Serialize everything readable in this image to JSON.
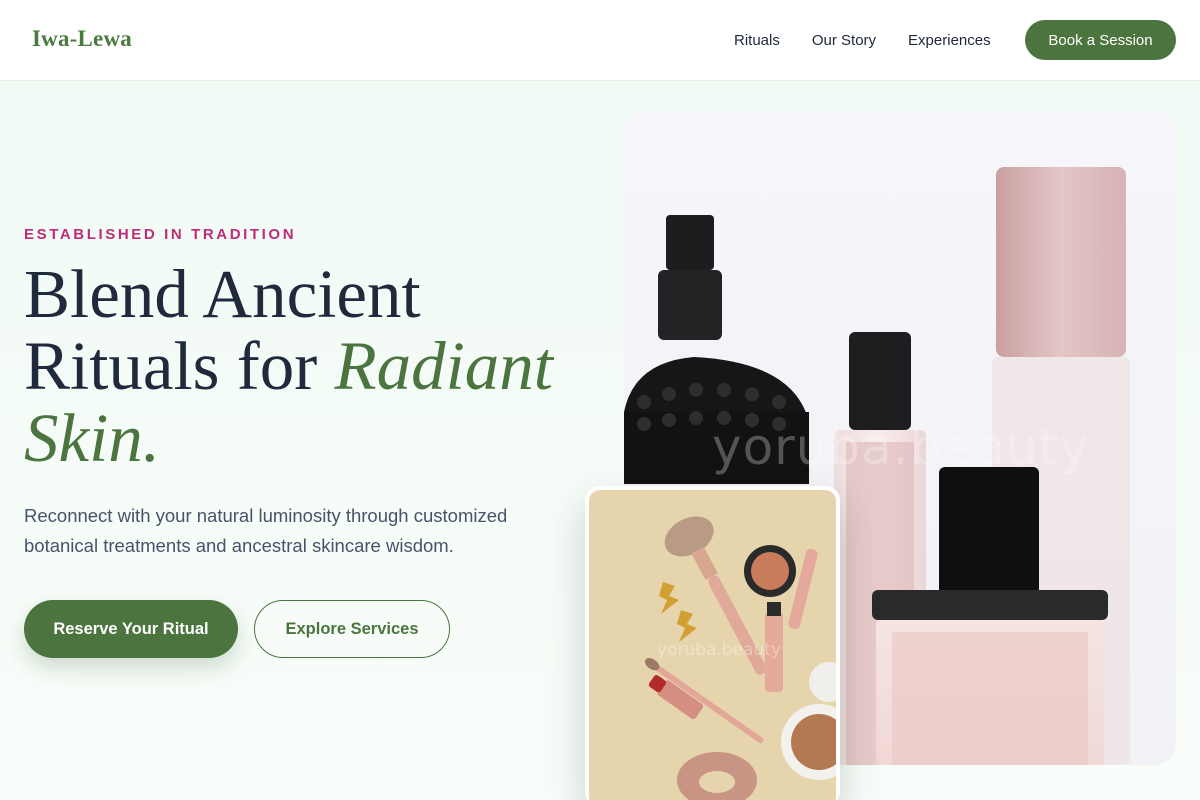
{
  "header": {
    "brand": "Iwa-Lewa",
    "nav": [
      "Rituals",
      "Our Story",
      "Experiences"
    ],
    "cta": "Book a Session"
  },
  "hero": {
    "eyebrow": "ESTABLISHED IN TRADITION",
    "headline_part1": "Blend Ancient Rituals for ",
    "headline_accent": "Radiant Skin.",
    "subtext": "Reconnect with your natural luminosity through customized botanical treatments and ancestral skincare wisdom.",
    "primary_button": "Reserve Your Ritual",
    "secondary_button": "Explore Services"
  },
  "images": {
    "main_watermark": "yoruba.beauty",
    "card_watermark": "yoruba.beauty"
  },
  "colors": {
    "brand_green": "#4b743f",
    "eyebrow_pink": "#c02b79",
    "headline_navy": "#1f2a3d",
    "background_mint": "#f3fbf6"
  }
}
